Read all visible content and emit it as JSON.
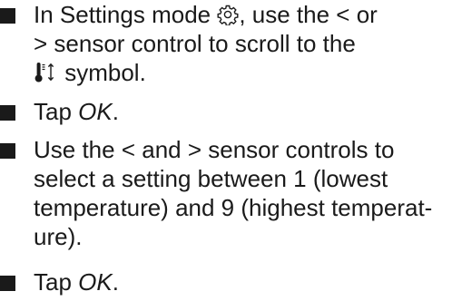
{
  "steps": [
    {
      "lines": [
        {
          "before": "In Settings mode ",
          "icon": "gear-icon",
          "after": ", use the < or"
        },
        {
          "text": "> sensor control to scroll to the"
        },
        {
          "icon": "thermometer-arrows-icon",
          "after": " symbol."
        }
      ]
    },
    {
      "before": "Tap ",
      "emph": "OK",
      "after": "."
    },
    {
      "lines": [
        "Use the < and > sensor controls to",
        "select a setting between 1 (lowest",
        "temperature) and 9 (highest temperat-",
        "ure)."
      ]
    },
    {
      "before": "Tap ",
      "emph": "OK",
      "after": "."
    }
  ]
}
